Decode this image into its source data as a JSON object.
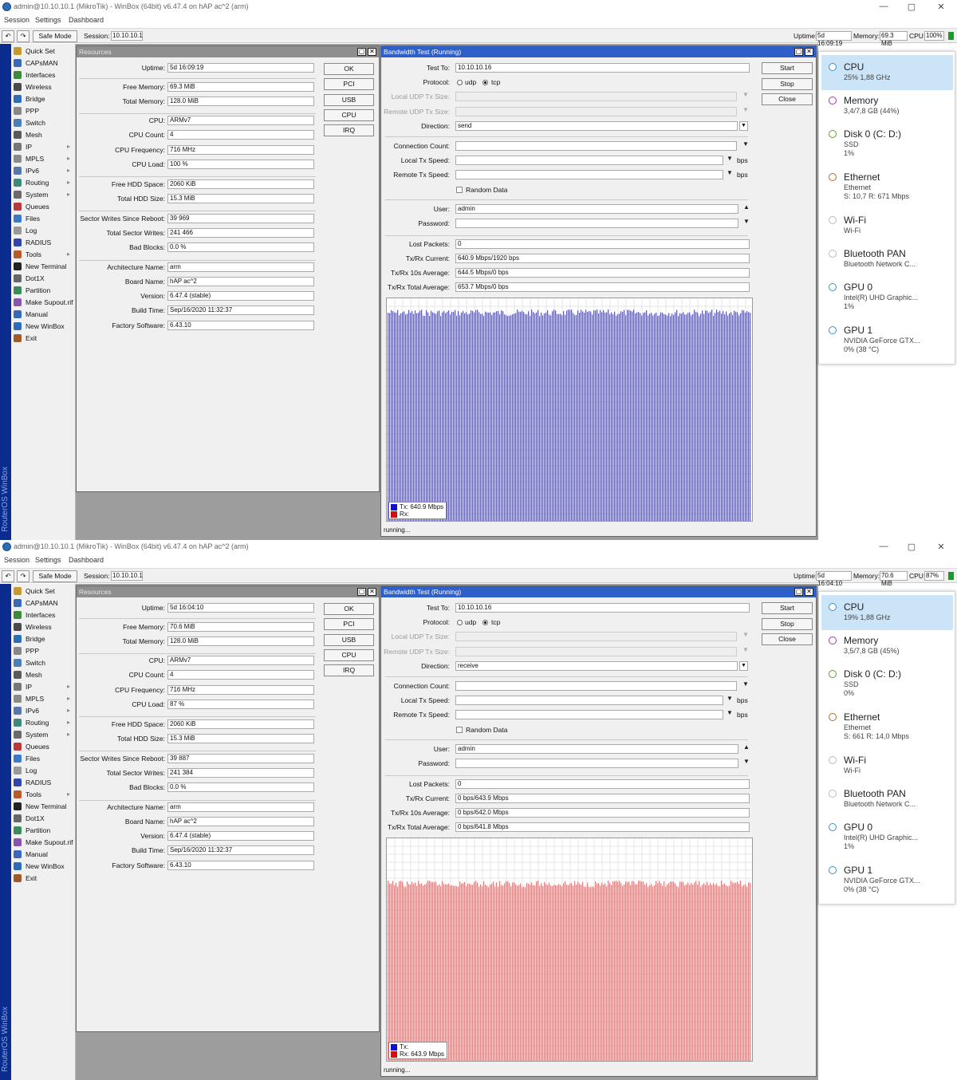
{
  "common": {
    "title": "admin@10.10.10.1 (MikroTik) - WinBox (64bit) v6.47.4 on hAP ac^2 (arm)",
    "menu": [
      "Session",
      "Settings",
      "Dashboard"
    ],
    "safe_mode": "Safe Mode",
    "session_label": "Session:",
    "session_value": "10.10.10.1",
    "uptime_label": "Uptime:",
    "memory_label": "Memory:",
    "cpu_label": "CPU:",
    "vertical_brand": "RouterOS WinBox",
    "sidebar": [
      {
        "label": "Quick Set",
        "icon": "quick-set-icon",
        "color": "#c79a2f",
        "arrow": ""
      },
      {
        "label": "CAPsMAN",
        "icon": "capsman-icon",
        "color": "#3b6ab5",
        "arrow": ""
      },
      {
        "label": "Interfaces",
        "icon": "interfaces-icon",
        "color": "#3c8a3c",
        "arrow": ""
      },
      {
        "label": "Wireless",
        "icon": "wireless-icon",
        "color": "#4a4a4a",
        "arrow": ""
      },
      {
        "label": "Bridge",
        "icon": "bridge-icon",
        "color": "#2d6db5",
        "arrow": ""
      },
      {
        "label": "PPP",
        "icon": "ppp-icon",
        "color": "#888888",
        "arrow": ""
      },
      {
        "label": "Switch",
        "icon": "switch-icon",
        "color": "#4a7fb5",
        "arrow": ""
      },
      {
        "label": "Mesh",
        "icon": "mesh-icon",
        "color": "#5a5a5a",
        "arrow": ""
      },
      {
        "label": "IP",
        "icon": "ip-icon",
        "color": "#777777",
        "arrow": "▸"
      },
      {
        "label": "MPLS",
        "icon": "mpls-icon",
        "color": "#8a8a8a",
        "arrow": "▸"
      },
      {
        "label": "IPv6",
        "icon": "ipv6-icon",
        "color": "#5577aa",
        "arrow": "▸"
      },
      {
        "label": "Routing",
        "icon": "routing-icon",
        "color": "#3d8a7a",
        "arrow": "▸"
      },
      {
        "label": "System",
        "icon": "system-icon",
        "color": "#6a6a6a",
        "arrow": "▸"
      },
      {
        "label": "Queues",
        "icon": "queues-icon",
        "color": "#b83a3a",
        "arrow": ""
      },
      {
        "label": "Files",
        "icon": "files-icon",
        "color": "#3a7ac8",
        "arrow": ""
      },
      {
        "label": "Log",
        "icon": "log-icon",
        "color": "#999999",
        "arrow": ""
      },
      {
        "label": "RADIUS",
        "icon": "radius-icon",
        "color": "#3344aa",
        "arrow": ""
      },
      {
        "label": "Tools",
        "icon": "tools-icon",
        "color": "#b85a2a",
        "arrow": "▸"
      },
      {
        "label": "New Terminal",
        "icon": "terminal-icon",
        "color": "#222222",
        "arrow": ""
      },
      {
        "label": "Dot1X",
        "icon": "dot1x-icon",
        "color": "#666666",
        "arrow": ""
      },
      {
        "label": "Partition",
        "icon": "partition-icon",
        "color": "#3a8a5a",
        "arrow": ""
      },
      {
        "label": "Make Supout.rif",
        "icon": "supout-icon",
        "color": "#8855aa",
        "arrow": ""
      },
      {
        "label": "Manual",
        "icon": "manual-icon",
        "color": "#3a6ab5",
        "arrow": ""
      },
      {
        "label": "New WinBox",
        "icon": "winbox-icon",
        "color": "#2d6db5",
        "arrow": ""
      },
      {
        "label": "Exit",
        "icon": "exit-icon",
        "color": "#a05a2a",
        "arrow": ""
      }
    ],
    "resources_title": "Resources",
    "res_labels": [
      "Uptime:",
      "Free Memory:",
      "Total Memory:",
      "CPU:",
      "CPU Count:",
      "CPU Frequency:",
      "CPU Load:",
      "Free HDD Space:",
      "Total HDD Size:",
      "Sector Writes Since Reboot:",
      "Total Sector Writes:",
      "Bad Blocks:",
      "Architecture Name:",
      "Board Name:",
      "Version:",
      "Build Time:",
      "Factory Software:"
    ],
    "res_buttons": [
      "OK",
      "PCI",
      "USB",
      "CPU",
      "IRQ"
    ],
    "bw_title": "Bandwidth Test (Running)",
    "bw_buttons": [
      "Start",
      "Stop",
      "Close"
    ],
    "bw_labels": {
      "test_to": "Test To:",
      "protocol": "Protocol:",
      "udp": "udp",
      "tcp": "tcp",
      "local_udp": "Local UDP Tx Size:",
      "remote_udp": "Remote UDP Tx Size:",
      "direction": "Direction:",
      "conn_count": "Connection Count:",
      "local_tx": "Local Tx Speed:",
      "remote_tx": "Remote Tx Speed:",
      "bps": "bps",
      "random_data": "Random Data",
      "user": "User:",
      "password": "Password:",
      "lost_packets": "Lost Packets:",
      "current": "Tx/Rx Current:",
      "avg10": "Tx/Rx 10s Average:",
      "total_avg": "Tx/Rx Total Average:"
    },
    "tx_label": "Tx:",
    "rx_label": "Rx:",
    "status": "running...",
    "tm_names": [
      "CPU",
      "Memory",
      "Disk 0 (C: D:)",
      "Ethernet",
      "Wi-Fi",
      "Bluetooth PAN",
      "GPU 0",
      "GPU 1"
    ],
    "tm_colors": [
      "#3b8fd0",
      "#a03aa8",
      "#5aa02c",
      "#b46a2a",
      "#bbbbbb",
      "#bbbbbb",
      "#3b8fd0",
      "#3b8fd0"
    ]
  },
  "shots": [
    {
      "uptime": "5d 16:09:19",
      "memory": "69.3 MiB",
      "cpu": "100%",
      "res_values": [
        "5d 16:09:19",
        "69.3 MiB",
        "128.0 MiB",
        "ARMv7",
        "4",
        "716 MHz",
        "100 %",
        "2060 KiB",
        "15.3 MiB",
        "39 969",
        "241 466",
        "0.0 %",
        "arm",
        "hAP ac^2",
        "6.47.4 (stable)",
        "Sep/16/2020 11:32:37",
        "6.43.10"
      ],
      "bw": {
        "test_to": "10.10.10.16",
        "protocol": "tcp",
        "direction": "send",
        "user": "admin",
        "lost_packets": "0",
        "current": "640.9 Mbps/1920 bps",
        "avg10": "644.5 Mbps/0 bps",
        "total_avg": "653.7 Mbps/0 bps"
      },
      "legend_tx": "640.9 Mbps",
      "legend_rx": "",
      "graph": {
        "series": "tx",
        "color": "#5a5aa8",
        "level": 0.95
      },
      "tm": [
        {
          "s1": "25%  1,88 GHz",
          "s2": ""
        },
        {
          "s1": "3,4/7,8 GB (44%)",
          "s2": ""
        },
        {
          "s1": "SSD",
          "s2": "1%"
        },
        {
          "s1": "Ethernet",
          "s2": "S: 10,7  R: 671 Mbps"
        },
        {
          "s1": "Wi-Fi",
          "s2": ""
        },
        {
          "s1": "Bluetooth Network C...",
          "s2": ""
        },
        {
          "s1": "Intel(R) UHD Graphic...",
          "s2": "1%"
        },
        {
          "s1": "NVIDIA GeForce GTX...",
          "s2": "0%  (38 °C)"
        }
      ]
    },
    {
      "uptime": "5d 16:04:10",
      "memory": "70.6 MiB",
      "cpu": "87%",
      "res_values": [
        "5d 16:04:10",
        "70.6 MiB",
        "128.0 MiB",
        "ARMv7",
        "4",
        "716 MHz",
        "87 %",
        "2060 KiB",
        "15.3 MiB",
        "39 887",
        "241 384",
        "0.0 %",
        "arm",
        "hAP ac^2",
        "6.47.4 (stable)",
        "Sep/16/2020 11:32:37",
        "6.43.10"
      ],
      "bw": {
        "test_to": "10.10.10.16",
        "protocol": "tcp",
        "direction": "receive",
        "user": "admin",
        "lost_packets": "0",
        "current": "0 bps/643.9 Mbps",
        "avg10": "0 bps/642.0 Mbps",
        "total_avg": "0 bps/641.8 Mbps"
      },
      "legend_tx": "",
      "legend_rx": "643.9 Mbps",
      "graph": {
        "series": "rx",
        "color": "#d98080",
        "level": 0.81
      },
      "tm": [
        {
          "s1": "19%  1,88 GHz",
          "s2": ""
        },
        {
          "s1": "3,5/7,8 GB (45%)",
          "s2": ""
        },
        {
          "s1": "SSD",
          "s2": "0%"
        },
        {
          "s1": "Ethernet",
          "s2": "S: 661  R: 14,0 Mbps"
        },
        {
          "s1": "Wi-Fi",
          "s2": ""
        },
        {
          "s1": "Bluetooth Network C...",
          "s2": ""
        },
        {
          "s1": "Intel(R) UHD Graphic...",
          "s2": "1%"
        },
        {
          "s1": "NVIDIA GeForce GTX...",
          "s2": "0%  (38 °C)"
        }
      ]
    }
  ]
}
